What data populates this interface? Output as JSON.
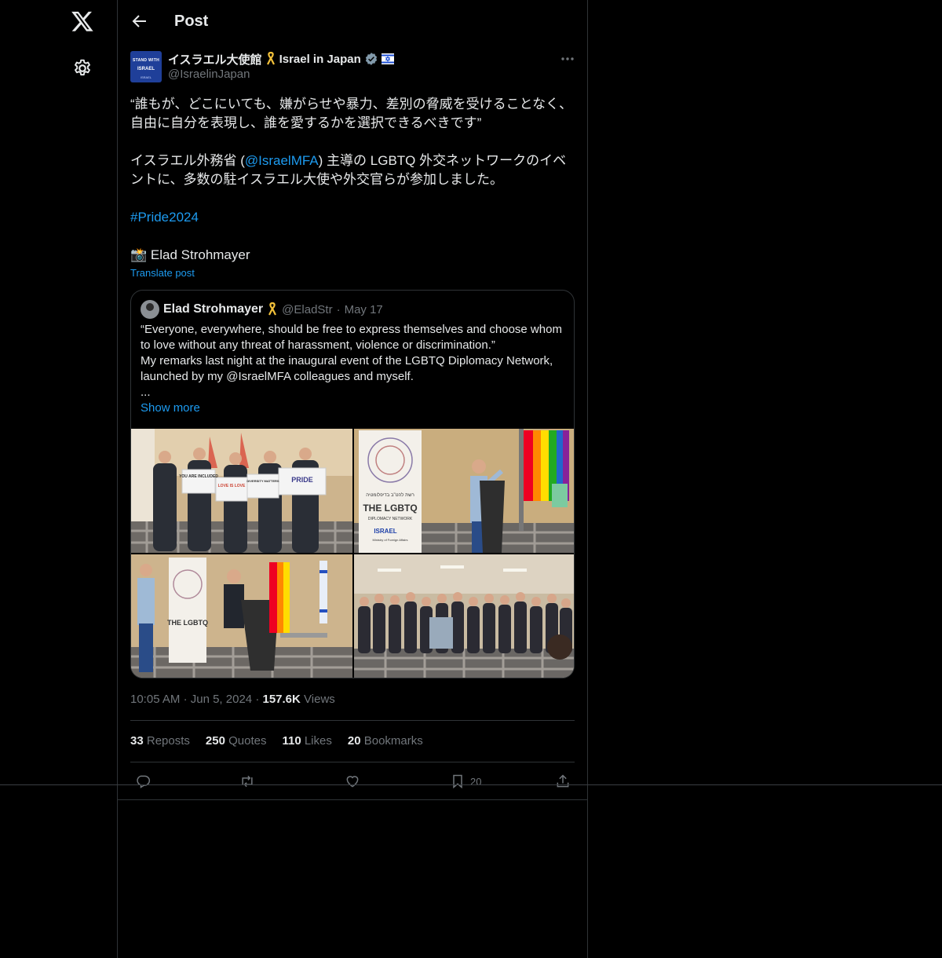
{
  "nav": {
    "logo_icon": "x-logo-icon",
    "settings_icon": "gear-icon"
  },
  "header": {
    "title": "Post"
  },
  "post": {
    "author": {
      "avatar_text": [
        "STAND WITH",
        "ISRAEL",
        "ISRAEL"
      ],
      "display_name_ja": "イスラエル大使館",
      "display_name_en": "Israel in Japan",
      "handle": "@IsraelinJapan"
    },
    "text": {
      "quote_line": "“誰もが、どこにいても、嫌がらせや暴力、差別の脅威を受けることなく、自由に自分を表現し、誰を愛するかを選択できるべきです”",
      "line2_prefix": "イスラエル外務省 (",
      "line2_mention": "@IsraelMFA",
      "line2_suffix": ") 主導の LGBTQ 外交ネットワークのイベントに、多数の駐イスラエル大使や外交官らが参加しました。",
      "hashtag": "#Pride2024",
      "credit": "📸 Elad Strohmayer"
    },
    "translate_label": "Translate post",
    "quoted": {
      "name": "Elad Strohmayer",
      "handle": "@EladStr",
      "dot": "·",
      "date": "May 17",
      "text_1": "“Everyone, everywhere, should be free to express themselves and choose whom to love without any threat of harassment, violence or discrimination.”",
      "text_2": "My remarks last night at the inaugural event of the LGBTQ Diplomacy Network, launched by my @IsraelMFA colleagues and myself.",
      "text_3": "...",
      "show_more": "Show more",
      "photo_signs": [
        "YOU ARE INCLUDED",
        "LOVE IS LOVE",
        "DIVERSITY MATTERS",
        "PRIDE"
      ],
      "banner_text": [
        "רשת להט\"ב בדיפלומטיה",
        "THE LGBTQ",
        "DIPLOMACY NETWORK",
        "ISRAEL",
        "Ministry of Foreign Affairs"
      ]
    },
    "meta": {
      "time": "10:05 AM",
      "dot1": "·",
      "date": "Jun 5, 2024",
      "dot2": "·",
      "views_count": "157.6K",
      "views_label": "Views"
    },
    "stats": [
      {
        "count": "33",
        "label": "Reposts"
      },
      {
        "count": "250",
        "label": "Quotes"
      },
      {
        "count": "110",
        "label": "Likes"
      },
      {
        "count": "20",
        "label": "Bookmarks"
      }
    ],
    "actions": {
      "bookmark_count": "20"
    }
  },
  "colors": {
    "background": "#000000",
    "text": "#e7e9ea",
    "muted": "#71767b",
    "link": "#1d9bf0",
    "border": "#2f3336"
  }
}
